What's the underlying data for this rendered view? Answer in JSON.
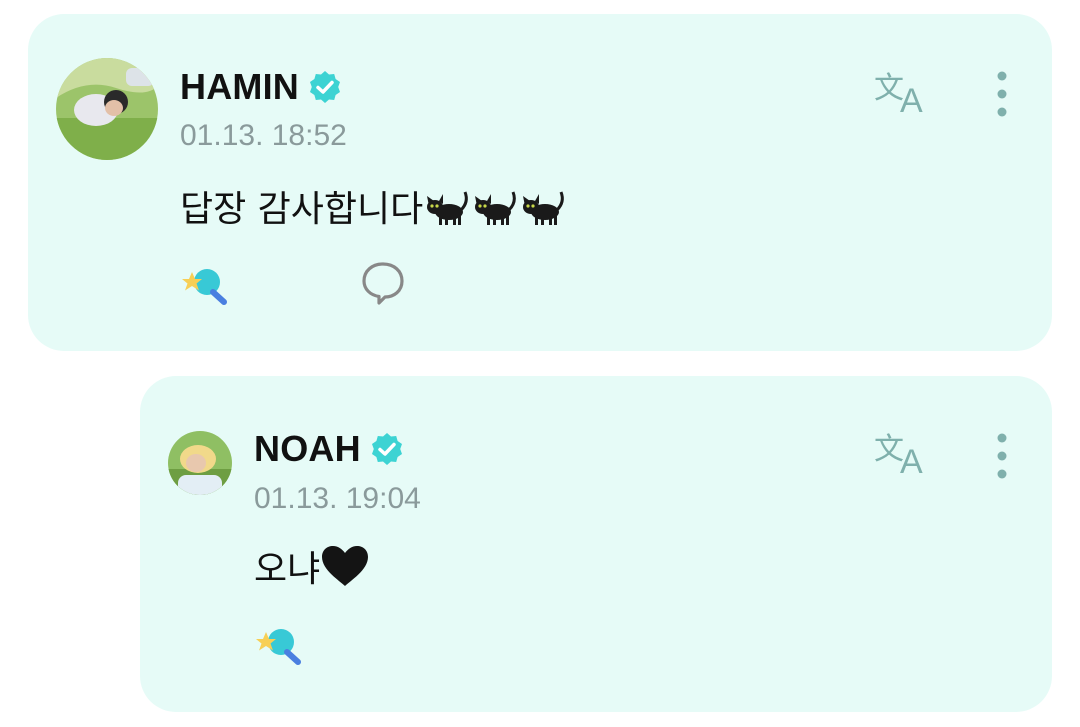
{
  "comments": [
    {
      "author": "HAMIN",
      "verified": true,
      "timestamp": "01.13. 18:52",
      "text": "답장 감사합니다",
      "emojis": [
        "black-cat",
        "black-cat",
        "black-cat"
      ],
      "actions": [
        "reaction-icon",
        "comment-icon",
        "translate-icon",
        "more-icon"
      ]
    },
    {
      "author": "NOAH",
      "verified": true,
      "timestamp": "01.13. 19:04",
      "text": "오냐",
      "emojis": [
        "black-heart"
      ],
      "actions": [
        "reaction-icon",
        "translate-icon",
        "more-icon"
      ]
    }
  ],
  "colors": {
    "card_bg": "#e6fbf7",
    "verified": "#3dd3d3",
    "icon": "#7fb0ac",
    "timestamp": "#8a9a9b"
  }
}
